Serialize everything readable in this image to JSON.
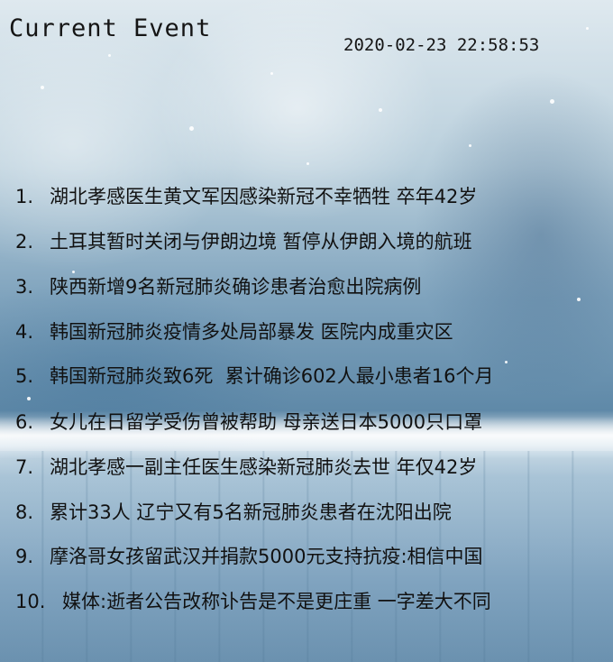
{
  "header": {
    "title": "Current Event",
    "timestamp": "2020-02-23 22:58:53"
  },
  "events": [
    {
      "num": "1.",
      "text": "湖北孝感医生黄文军因感染新冠不幸牺牲 卒年42岁"
    },
    {
      "num": "2.",
      "text": "土耳其暂时关闭与伊朗边境 暂停从伊朗入境的航班"
    },
    {
      "num": "3.",
      "text": "陕西新增9名新冠肺炎确诊患者治愈出院病例"
    },
    {
      "num": "4.",
      "text": "韩国新冠肺炎疫情多处局部暴发 医院内成重灾区"
    },
    {
      "num": "5.",
      "text": "韩国新冠肺炎致6死  累计确诊602人最小患者16个月"
    },
    {
      "num": "6.",
      "text": "女儿在日留学受伤曾被帮助 母亲送日本5000只口罩"
    },
    {
      "num": "7.",
      "text": "湖北孝感一副主任医生感染新冠肺炎去世 年仅42岁"
    },
    {
      "num": "8.",
      "text": "累计33人 辽宁又有5名新冠肺炎患者在沈阳出院"
    },
    {
      "num": "9.",
      "text": "摩洛哥女孩留武汉并捐款5000元支持抗疫:相信中国"
    },
    {
      "num": "10.",
      "text": "媒体:逝者公告改称讣告是不是更庄重 一字差大不同"
    }
  ]
}
